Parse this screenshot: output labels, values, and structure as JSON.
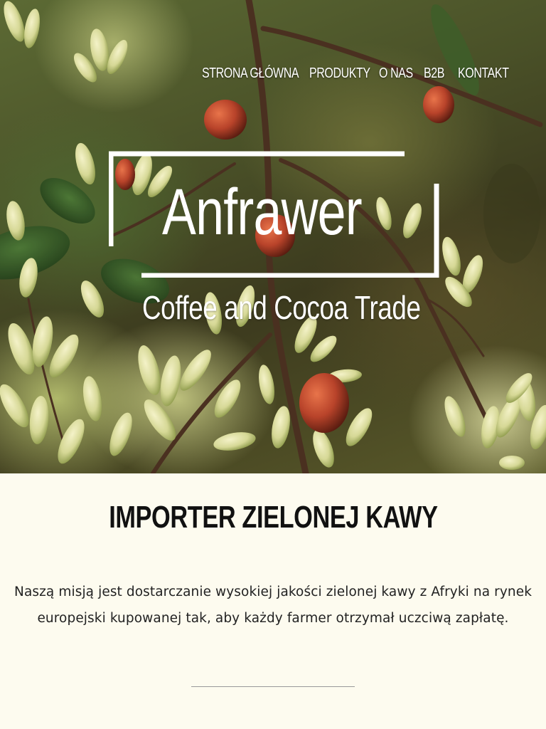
{
  "nav": {
    "items": [
      {
        "label": "STRONA GŁÓWNA"
      },
      {
        "label": "PRODUKTY"
      },
      {
        "label": "O NAS"
      },
      {
        "label": "B2B"
      },
      {
        "label": "KONTAKT"
      }
    ]
  },
  "logo": {
    "title": "Anfrawer",
    "subtitle": "Coffee and Cocoa Trade"
  },
  "hero": {
    "image": "coffee-plant-branch-with-blossoms-and-cherries"
  },
  "content": {
    "heading": "IMPORTER ZIELONEJ KAWY",
    "mission": "Naszą misją jest dostarczanie wysokiej jakości zielonej kawy z Afryki na rynek europejski kupowanej tak, aby każdy farmer otrzymał uczciwą zapłatę."
  },
  "colors": {
    "page_background": "#fdfbef",
    "heading_text": "#111111",
    "body_text": "#222222",
    "hero_text": "#ffffff",
    "divider": "#999999",
    "cherry": "#b8432a"
  }
}
